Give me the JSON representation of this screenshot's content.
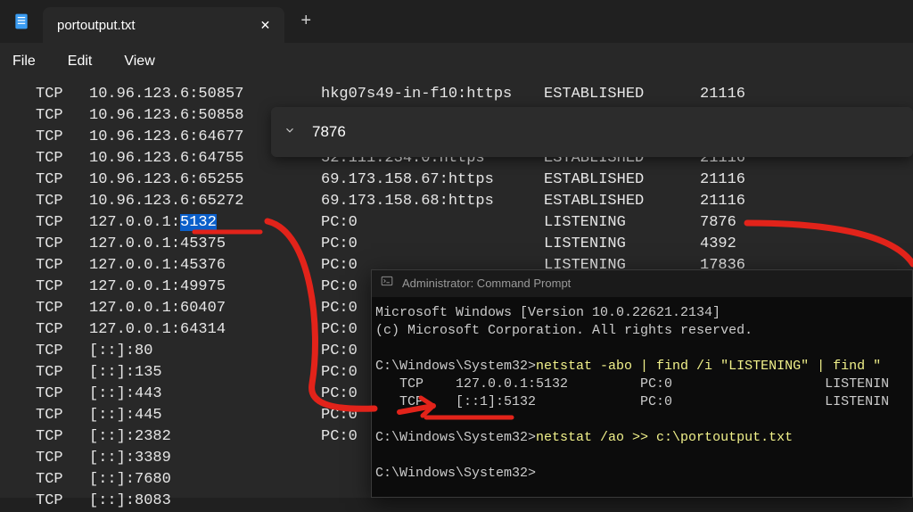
{
  "tab": {
    "title": "portoutput.txt"
  },
  "menu": {
    "file": "File",
    "edit": "Edit",
    "view": "View"
  },
  "find": {
    "value": "7876"
  },
  "editor_rows": [
    {
      "proto": "TCP",
      "local": "10.96.123.6:50857",
      "remote": "hkg07s49-in-f10:https",
      "state": "ESTABLISHED",
      "pid": "21116"
    },
    {
      "proto": "TCP",
      "local": "10.96.123.6:50858",
      "remote": "",
      "state": "",
      "pid": ""
    },
    {
      "proto": "TCP",
      "local": "10.96.123.6:64677",
      "remote": "",
      "state": "",
      "pid": ""
    },
    {
      "proto": "TCP",
      "local": "10.96.123.6:64755",
      "remote": "52.111.234.0:https",
      "state": "ESTABLISHED",
      "pid": "21116"
    },
    {
      "proto": "TCP",
      "local": "10.96.123.6:65255",
      "remote": "69.173.158.67:https",
      "state": "ESTABLISHED",
      "pid": "21116"
    },
    {
      "proto": "TCP",
      "local": "10.96.123.6:65272",
      "remote": "69.173.158.68:https",
      "state": "ESTABLISHED",
      "pid": "21116"
    },
    {
      "proto": "TCP",
      "local": "127.0.0.1:5132",
      "remote": "PC:0",
      "state": "LISTENING",
      "pid": "7876",
      "sel_from": 10
    },
    {
      "proto": "TCP",
      "local": "127.0.0.1:45375",
      "remote": "PC:0",
      "state": "LISTENING",
      "pid": "4392"
    },
    {
      "proto": "TCP",
      "local": "127.0.0.1:45376",
      "remote": "PC:0",
      "state": "LISTENING",
      "pid": "17836"
    },
    {
      "proto": "TCP",
      "local": "127.0.0.1:49975",
      "remote": "PC:0",
      "state": "",
      "pid": ""
    },
    {
      "proto": "TCP",
      "local": "127.0.0.1:60407",
      "remote": "PC:0",
      "state": "",
      "pid": ""
    },
    {
      "proto": "TCP",
      "local": "127.0.0.1:64314",
      "remote": "PC:0",
      "state": "",
      "pid": ""
    },
    {
      "proto": "TCP",
      "local": "[::]:80",
      "remote": "PC:0",
      "state": "",
      "pid": ""
    },
    {
      "proto": "TCP",
      "local": "[::]:135",
      "remote": "PC:0",
      "state": "",
      "pid": ""
    },
    {
      "proto": "TCP",
      "local": "[::]:443",
      "remote": "PC:0",
      "state": "",
      "pid": ""
    },
    {
      "proto": "TCP",
      "local": "[::]:445",
      "remote": "PC:0",
      "state": "",
      "pid": ""
    },
    {
      "proto": "TCP",
      "local": "[::]:2382",
      "remote": "PC:0",
      "state": "",
      "pid": ""
    },
    {
      "proto": "TCP",
      "local": "[::]:3389",
      "remote": "",
      "state": "",
      "pid": ""
    },
    {
      "proto": "TCP",
      "local": "[::]:7680",
      "remote": "",
      "state": "",
      "pid": ""
    },
    {
      "proto": "TCP",
      "local": "[::]:8083",
      "remote": "",
      "state": "",
      "pid": ""
    }
  ],
  "cmd": {
    "title": "Administrator: Command Prompt",
    "banner1": "Microsoft Windows [Version 10.0.22621.2134]",
    "banner2": "(c) Microsoft Corporation. All rights reserved.",
    "prompt1a": "C:\\Windows\\System32>",
    "cmd1": "netstat -abo | find /i \"LISTENING\" | find \"",
    "out1": "   TCP    127.0.0.1:5132         PC:0                   LISTENIN",
    "out2": "   TCP    [::1]:5132             PC:0                   LISTENIN",
    "prompt2a": "C:\\Windows\\System32>",
    "cmd2": "netstat /ao >> c:\\portoutput.txt",
    "prompt3": "C:\\Windows\\System32>"
  }
}
